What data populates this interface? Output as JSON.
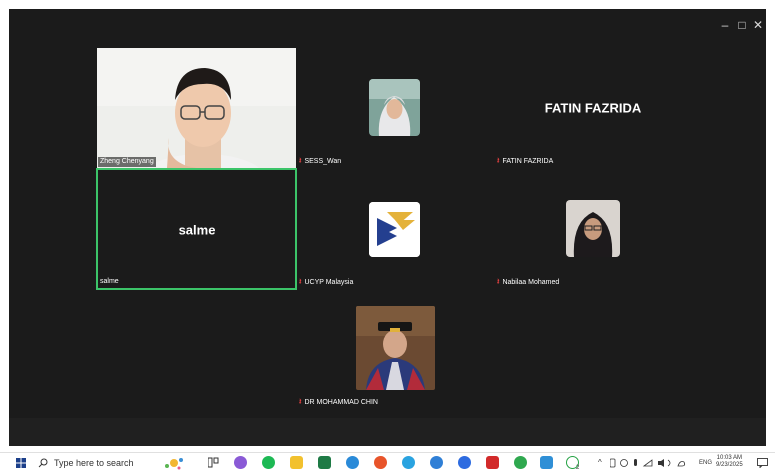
{
  "window_controls": {
    "minimize": "–",
    "maximize": "□",
    "close": "✕"
  },
  "participants": {
    "zheng": {
      "name": "Zheng Chenyang"
    },
    "sess": {
      "name": "SESS_Wan"
    },
    "fatin": {
      "display": "FATIN FAZRIDA",
      "name": "FATIN FAZRIDA"
    },
    "salme": {
      "display": "salme",
      "name": "salme"
    },
    "ucyp": {
      "name": "UCYP Malaysia"
    },
    "nabilaa": {
      "name": "Nabilaa Mohamed"
    },
    "chin": {
      "name": "DR MOHAMMAD CHIN"
    }
  },
  "colors": {
    "meeting_bg": "#1b1b1b",
    "active_speaker_border": "#3cc469",
    "muted_icon": "#e04040"
  },
  "taskbar": {
    "search_placeholder": "Type here to search",
    "language": "ENG",
    "time": "10:03 AM",
    "date": "9/23/2025",
    "whatsapp_badge": "2",
    "icons": [
      "windows-start-icon",
      "search-icon",
      "copilot-icon",
      "task-view-icon",
      "color-app-icon",
      "spotify-icon",
      "file-explorer-icon",
      "excel-icon",
      "chrome-icon",
      "opera-icon",
      "telegram-icon",
      "edge-icon",
      "zoom-icon",
      "acrobat-icon",
      "green-app-icon",
      "sticky-notes-icon",
      "whatsapp-icon"
    ]
  }
}
